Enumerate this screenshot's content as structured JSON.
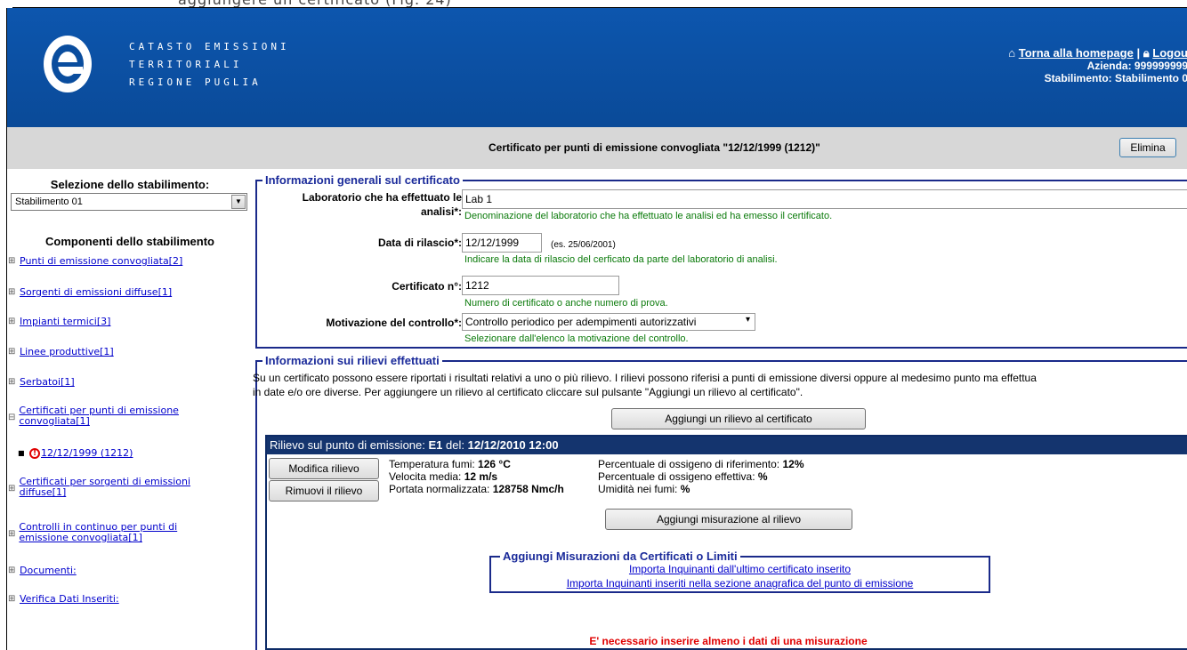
{
  "top_strip_text": "aggiungere un certificato (Fig. 24)",
  "header": {
    "brand_lines": [
      "CATASTO EMISSIONI",
      "TERRITORIALI",
      "REGIONE PUGLIA"
    ],
    "home_link": "Torna alla homepage",
    "separator": "|",
    "logout_link": "Logou",
    "azienda": "Azienda: 999999999",
    "stabilimento": "Stabilimento: Stabilimento 0",
    "brand_color": "#0a4d9e"
  },
  "titlebar": {
    "title": "Certificato per punti di emissione convogliata \"12/12/1999 (1212)\"",
    "delete_button": "Elimina"
  },
  "sidebar": {
    "select_title": "Selezione dello stabilimento:",
    "selected_plant": "Stabilimento 01",
    "components_title": "Componenti dello stabilimento",
    "items": [
      {
        "pm": "⊞",
        "label": "Punti di emissione convogliata[2]"
      },
      {
        "pm": "⊞",
        "label": "Sorgenti di emissioni diffuse[1]"
      },
      {
        "pm": "⊞",
        "label": "Impianti termici[3]"
      },
      {
        "pm": "⊞",
        "label": "Linee produttive[1]"
      },
      {
        "pm": "⊞",
        "label": "Serbatoi[1]"
      },
      {
        "pm": "⊟",
        "label": "Certificati per punti di emissione convogliata[1]"
      },
      {
        "pm": "■",
        "label": "12/12/1999 (1212)"
      },
      {
        "pm": "⊞",
        "label": "Certificati per sorgenti di emissioni diffuse[1]"
      },
      {
        "pm": "⊞",
        "label": "Controlli in continuo per punti di emissione convogliata[1]"
      },
      {
        "pm": "⊞",
        "label": "Documenti:"
      },
      {
        "pm": "⊞",
        "label": "Verifica Dati Inseriti:"
      }
    ]
  },
  "general": {
    "legend": "Informazioni generali sul certificato",
    "lab_label_1": "Laboratorio che ha effettuato le",
    "lab_label_2": "analisi*:",
    "lab_value": "Lab 1",
    "lab_hint": "Denominazione del laboratorio che ha effettuato le analisi ed ha emesso il certificato.",
    "date_label": "Data di rilascio*:",
    "date_value": "12/12/1999",
    "date_example": "(es. 25/06/2001)",
    "date_hint": "Indicare la data di rilascio del cerficato da parte del laboratorio di analisi.",
    "cert_label": "Certificato n°:",
    "cert_value": "1212",
    "cert_hint": "Numero di certificato o anche numero di prova.",
    "motiv_label": "Motivazione del controllo*:",
    "motiv_value": "Controllo periodico per adempimenti autorizzativi",
    "motiv_hint": "Selezionare dall'elenco la motivazione del controllo."
  },
  "rilievi": {
    "legend": "Informazioni sui rilievi effettuati",
    "desc_1": "Su un certificato possono essere riportati i  risultati relativi a uno o più rilievo. I rilievi possono riferisi a punti di emissione diversi oppure al medesimo punto ma effettua",
    "desc_2": "in date e/o ore diverse. Per aggiungere un rilievo al certificato cliccare sul pulsante \"Aggiungi un rilievo al certificato\".",
    "add_button": "Aggiungi un rilievo al certificato"
  },
  "rilievo": {
    "head_prefix": "Rilievo sul punto di emissione:",
    "point": "E1",
    "del": "del:",
    "datetime": "12/12/2010 12:00",
    "modify_button": "Modifica rilievo",
    "remove_button": "Rimuovi il rilievo",
    "temp_label": "Temperatura fumi:",
    "temp_value": "126 °C",
    "vel_label": "Velocita media:",
    "vel_value": "12 m/s",
    "port_label": "Portata normalizzata:",
    "port_value": "128758 Nmc/h",
    "ox_ref_label": "Percentuale di ossigeno di riferimento:",
    "ox_ref_value": "12%",
    "ox_eff_label": "Percentuale di ossigeno effettiva:",
    "ox_eff_value": "%",
    "hum_label": "Umidità nei fumi:",
    "hum_value": "%",
    "add_meas_button": "Aggiungi misurazione al rilievo",
    "import_legend": "Aggiungi Misurazioni da Certificati o Limiti",
    "import_link_1": "Importa Inquinanti dall'ultimo certificato inserito",
    "import_link_2": "Importa Inquinanti inseriti nella sezione anagrafica del punto di emissione",
    "error": "E' necessario inserire almeno i dati di una misurazione"
  }
}
